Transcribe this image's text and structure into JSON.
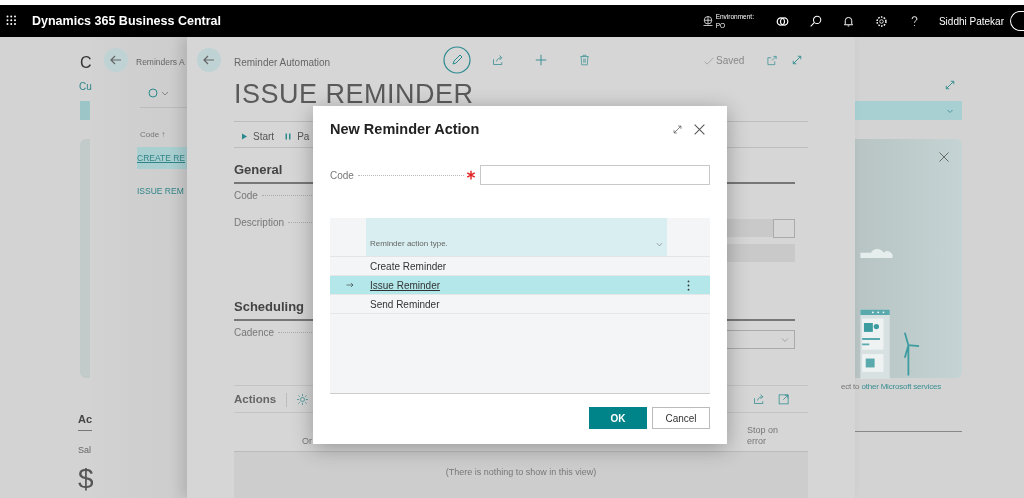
{
  "top_bar": {
    "app_title": "Dynamics 365 Business Central",
    "environment_label": "Environment:",
    "environment_value": "PO",
    "user_name": "Siddhi Patekar"
  },
  "back_page": {
    "title": "C",
    "link": "Cu",
    "section_heading": "Ac",
    "caption": "Sal",
    "value": "$",
    "card_text": "ect to",
    "card_link": "other Microsoft services"
  },
  "list_page": {
    "title": "Reminders A",
    "column": "Code ↑",
    "rows": [
      {
        "code": "CREATE RE",
        "selected": true
      },
      {
        "code": "ISSUE REM",
        "selected": false
      }
    ]
  },
  "card_page": {
    "breadcrumb": "Reminder Automation",
    "status": "Saved",
    "title": "ISSUE REMINDER",
    "actions": [
      {
        "label": "Start",
        "kind": "play"
      },
      {
        "label": "Pa",
        "kind": "pause"
      }
    ],
    "general": {
      "heading": "General",
      "fields": [
        {
          "label": "Code"
        },
        {
          "label": "Description"
        }
      ]
    },
    "scheduling": {
      "heading": "Scheduling",
      "fields": [
        {
          "label": "Cadence"
        }
      ]
    },
    "actions_part": {
      "heading": "Actions",
      "columns": [
        "Or",
        "Stop on error"
      ],
      "empty_message": "(There is nothing to show in this view)"
    }
  },
  "dialog": {
    "title": "New Reminder Action",
    "code_label": "Code",
    "code_required": true,
    "list": {
      "column": "Reminder action type.",
      "rows": [
        {
          "label": "Create Reminder",
          "selected": false
        },
        {
          "label": "Issue Reminder",
          "selected": true
        },
        {
          "label": "Send Reminder",
          "selected": false
        }
      ]
    },
    "buttons": [
      {
        "label": "OK",
        "kind": "primary"
      },
      {
        "label": "Cancel",
        "kind": "secondary"
      }
    ]
  }
}
